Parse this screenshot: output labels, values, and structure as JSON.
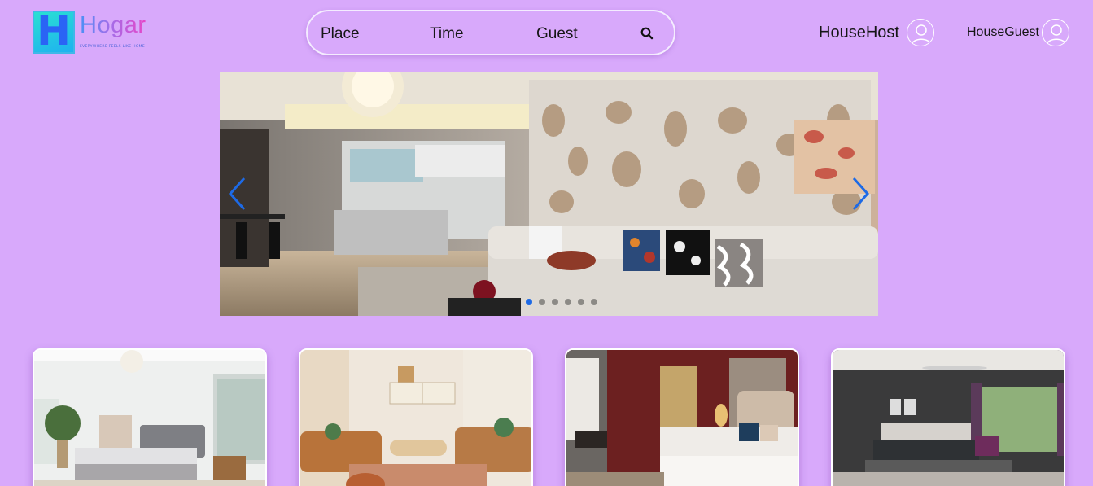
{
  "brand": {
    "name": "Hogar",
    "logo_letter": "H",
    "tagline": "EVERYWHERE FEELS LIKE HOME",
    "gradient": [
      "#4a90f5",
      "#a26ee9",
      "#e845c6"
    ]
  },
  "search": {
    "place_label": "Place",
    "time_label": "Time",
    "guest_label": "Guest",
    "button_icon": "search-icon"
  },
  "nav": {
    "host_label": "HouseHost",
    "guest_label": "HouseGuest",
    "avatar_icon": "user-avatar-icon"
  },
  "carousel": {
    "prev_icon": "chevron-left-icon",
    "next_icon": "chevron-right-icon",
    "slide_count": 6,
    "active_index": 0,
    "arrow_color": "#1d6ae6"
  },
  "listings": [
    {
      "scene": "white bedroom with grey bed and plants"
    },
    {
      "scene": "boho living room with leather sofas"
    },
    {
      "scene": "hotel room with red wall and tufted headboard"
    },
    {
      "scene": "dark bedroom with ceiling fan and balcony"
    }
  ],
  "colors": {
    "background": "#d8a9fb",
    "accent": "#1d6ae6"
  }
}
